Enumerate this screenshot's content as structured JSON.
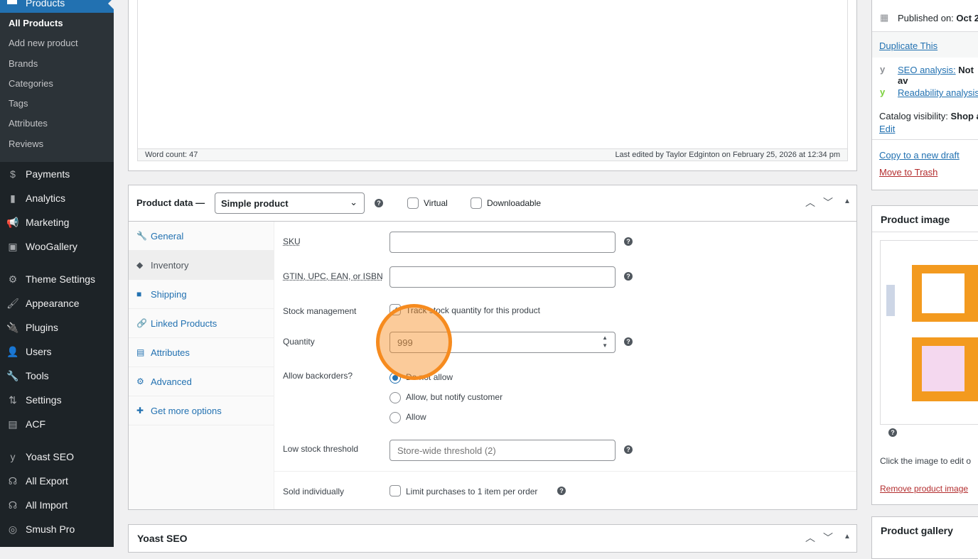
{
  "sidebar": {
    "products": "Products",
    "submenu": [
      "All Products",
      "Add new product",
      "Brands",
      "Categories",
      "Tags",
      "Attributes",
      "Reviews"
    ],
    "items": [
      {
        "label": "Payments",
        "icon": "payments-icon",
        "g": "$"
      },
      {
        "label": "Analytics",
        "icon": "analytics-icon",
        "g": "▮"
      },
      {
        "label": "Marketing",
        "icon": "megaphone-icon",
        "g": "📢"
      },
      {
        "label": "WooGallery",
        "icon": "gallery-icon",
        "g": "▣"
      },
      {
        "label": "Theme Settings",
        "icon": "gear-icon",
        "g": "⚙"
      },
      {
        "label": "Appearance",
        "icon": "brush-icon",
        "g": "🖌"
      },
      {
        "label": "Plugins",
        "icon": "plugin-icon",
        "g": "🔌"
      },
      {
        "label": "Users",
        "icon": "user-icon",
        "g": "👤"
      },
      {
        "label": "Tools",
        "icon": "wrench-icon",
        "g": "🔧"
      },
      {
        "label": "Settings",
        "icon": "settings-icon",
        "g": "⇅"
      },
      {
        "label": "ACF",
        "icon": "acf-icon",
        "g": "▤"
      },
      {
        "label": "Yoast SEO",
        "icon": "yoast-icon",
        "g": "y"
      },
      {
        "label": "All Export",
        "icon": "export-icon",
        "g": "☊"
      },
      {
        "label": "All Import",
        "icon": "import-icon",
        "g": "☊"
      },
      {
        "label": "Smush Pro",
        "icon": "smush-icon",
        "g": "◎"
      }
    ]
  },
  "editor": {
    "word_count": "Word count: 47",
    "last_edited": "Last edited by Taylor Edginton on February 25, 2026 at 12:34 pm"
  },
  "product_data": {
    "title": "Product data —",
    "type": "Simple product",
    "virtual": "Virtual",
    "downloadable": "Downloadable",
    "tabs": [
      {
        "label": "General",
        "g": "🔧"
      },
      {
        "label": "Inventory",
        "g": "◆"
      },
      {
        "label": "Shipping",
        "g": "■"
      },
      {
        "label": "Linked Products",
        "g": "🔗"
      },
      {
        "label": "Attributes",
        "g": "▤"
      },
      {
        "label": "Advanced",
        "g": "⚙"
      },
      {
        "label": "Get more options",
        "g": "✚"
      }
    ],
    "sku": "SKU",
    "gtin": "GTIN, UPC, EAN, or ISBN",
    "stock_mgmt": "Stock management",
    "track": "Track stock quantity for this product",
    "quantity_label": "Quantity",
    "quantity": "999",
    "backorders": "Allow backorders?",
    "bo_options": [
      "Do not allow",
      "Allow, but notify customer",
      "Allow"
    ],
    "low_stock": "Low stock threshold",
    "low_stock_placeholder": "Store-wide threshold (2)",
    "sold_ind": "Sold individually",
    "limit": "Limit purchases to 1 item per order"
  },
  "yoast": {
    "title": "Yoast SEO"
  },
  "publish": {
    "published": "Published on:",
    "date": "Oct 2",
    "duplicate": "Duplicate This",
    "seo": "SEO analysis:",
    "seo_val": "Not av",
    "readability": "Readability analysis:",
    "catalog": "Catalog visibility:",
    "catalog_val": "Shop a",
    "edit": "Edit",
    "copy": "Copy to a new draft",
    "trash": "Move to Trash"
  },
  "product_image": {
    "title": "Product image",
    "hint": "Click the image to edit o",
    "remove": "Remove product image"
  },
  "product_gallery": {
    "title": "Product gallery"
  },
  "colors": {
    "accent": "#2271b1",
    "highlight": "#f68b1f"
  }
}
